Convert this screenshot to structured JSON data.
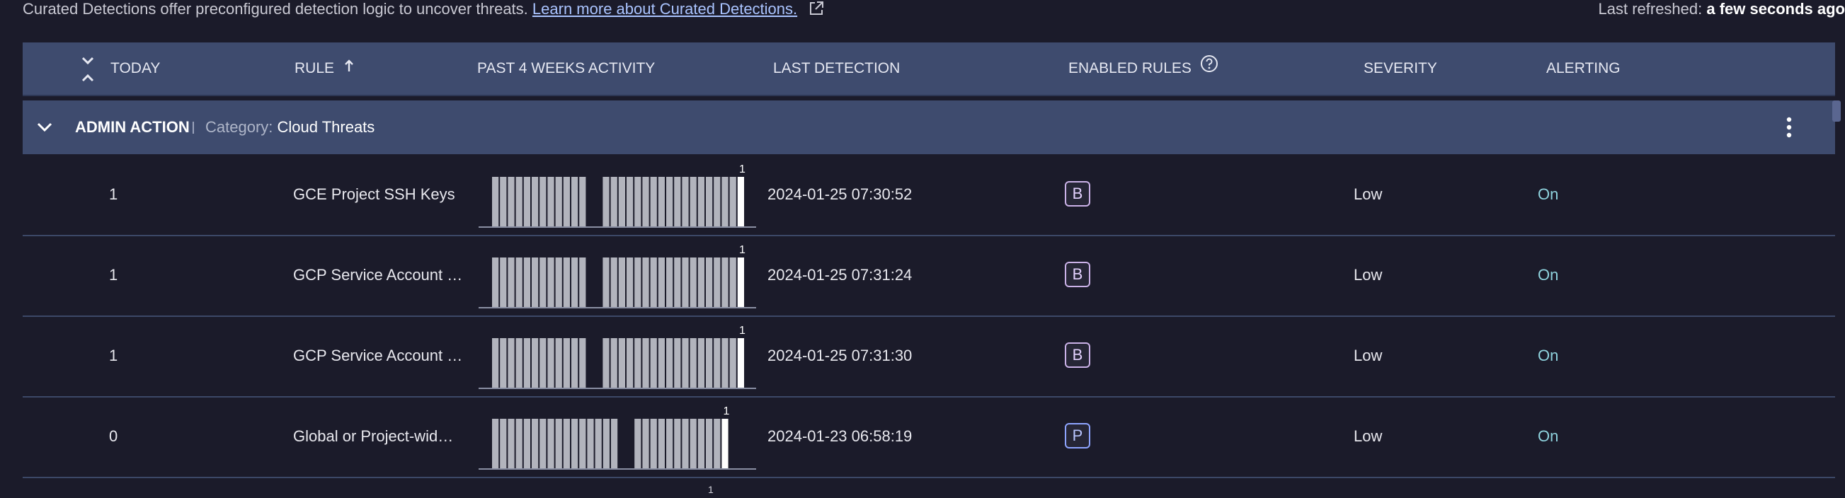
{
  "top": {
    "description": "Curated Detections offer preconfigured detection logic to uncover threats.",
    "learn_more": "Learn more about Curated Detections.",
    "refreshed_label": "Last refreshed:",
    "refreshed_value": "a few seconds ago"
  },
  "columns": {
    "today": "TODAY",
    "rule": "RULE",
    "past": "PAST 4 WEEKS ACTIVITY",
    "last": "LAST DETECTION",
    "enabled": "ENABLED RULES",
    "severity": "SEVERITY",
    "alerting": "ALERTING"
  },
  "group": {
    "name": "ADMIN ACTION",
    "category_label": "Category:",
    "category_value": "Cloud Threats"
  },
  "rows": [
    {
      "today": "1",
      "rule": "GCE Project SSH Keys",
      "last": "2024-01-25 07:30:52",
      "badge": "B",
      "severity": "Low",
      "alerting": "On",
      "spark_max": "1",
      "activity": {
        "segments": [
          12,
          18
        ],
        "peak_last": true
      }
    },
    {
      "today": "1",
      "rule": "GCP Service Account …",
      "last": "2024-01-25 07:31:24",
      "badge": "B",
      "severity": "Low",
      "alerting": "On",
      "spark_max": "1",
      "activity": {
        "segments": [
          12,
          18
        ],
        "peak_last": true
      }
    },
    {
      "today": "1",
      "rule": "GCP Service Account …",
      "last": "2024-01-25 07:31:30",
      "badge": "B",
      "severity": "Low",
      "alerting": "On",
      "spark_max": "1",
      "activity": {
        "segments": [
          12,
          18
        ],
        "peak_last": true
      }
    },
    {
      "today": "0",
      "rule": "Global or Project-wid…",
      "last": "2024-01-23 06:58:19",
      "badge": "P",
      "severity": "Low",
      "alerting": "On",
      "spark_max": "1",
      "activity": {
        "segments": [
          16,
          12
        ],
        "peak_last": true
      }
    }
  ],
  "partial_row_spark_max": "1",
  "colors": {
    "header_bg": "#3e4b6e",
    "page_bg": "#1b1b2a",
    "on": "#8fd3de",
    "badge_b": "#cbb2e8",
    "badge_p": "#8ea4ff"
  }
}
